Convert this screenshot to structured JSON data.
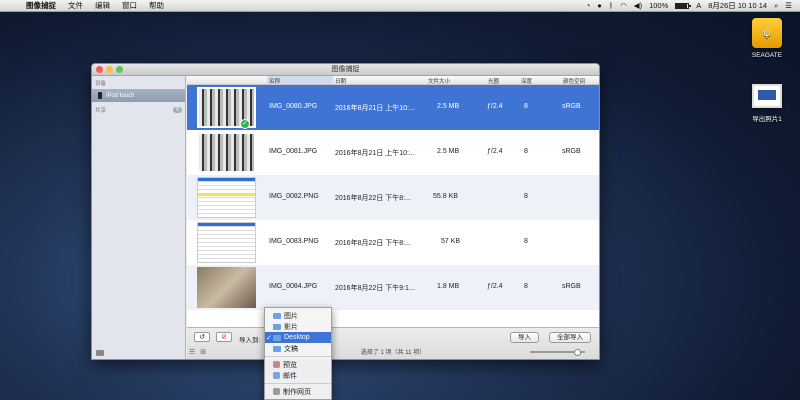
{
  "menubar": {
    "app_name": "图像捕捉",
    "menus": [
      "文件",
      "编辑",
      "窗口",
      "帮助"
    ],
    "battery": "100%",
    "datetime": "8月26日 10 10 14",
    "keyboard": "A"
  },
  "desktop": {
    "drive_label": "SEAGATE",
    "screenshot_label": "导出照片1"
  },
  "window": {
    "title": "图像捕捉",
    "sidebar": {
      "devices_header": "设备",
      "device_name": "iPod touch",
      "shared_header": "共享",
      "shared_count": "0"
    },
    "columns": [
      "名称",
      "日期",
      "文件大小",
      "光圈",
      "深度",
      "颜色空间"
    ],
    "rows": [
      {
        "name": "IMG_0080.JPG",
        "date": "2016年8月21日 上午10:...",
        "size": "2.5 MB",
        "aperture": "ƒ/2.4",
        "depth": "8",
        "colorspace": "sRGB"
      },
      {
        "name": "IMG_0081.JPG",
        "date": "2016年8月21日 上午10:...",
        "size": "2.5 MB",
        "aperture": "ƒ/2.4",
        "depth": "8",
        "colorspace": "sRGB"
      },
      {
        "name": "IMG_0082.PNG",
        "date": "2016年8月22日 下午8:...",
        "size": "55.8 KB",
        "aperture": "",
        "depth": "8",
        "colorspace": ""
      },
      {
        "name": "IMG_0083.PNG",
        "date": "2016年8月22日 下午8:...",
        "size": "57 KB",
        "aperture": "",
        "depth": "8",
        "colorspace": ""
      },
      {
        "name": "IMG_0084.JPG",
        "date": "2016年8月22日 下午9:1...",
        "size": "1.8 MB",
        "aperture": "ƒ/2.4",
        "depth": "8",
        "colorspace": "sRGB"
      }
    ],
    "bottom": {
      "import_to_label": "导入到:",
      "import_button": "导入",
      "import_all_button": "全部导入",
      "status": "选择了 1 项（共 11 项）"
    }
  },
  "popup": {
    "items": [
      "图片",
      "影片",
      "Desktop",
      "文稿",
      "预览",
      "邮件",
      "制作网页"
    ],
    "selected": "Desktop"
  }
}
